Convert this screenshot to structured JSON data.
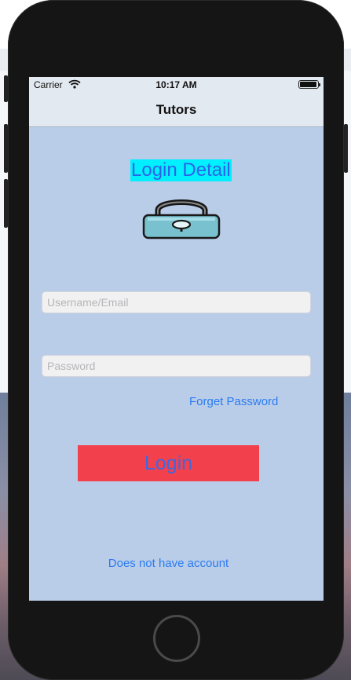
{
  "status_bar": {
    "carrier": "Carrier",
    "time": "10:17 AM"
  },
  "nav": {
    "title": "Tutors"
  },
  "main": {
    "heading": "Login Detail",
    "username": {
      "placeholder": "Username/Email",
      "value": ""
    },
    "password": {
      "placeholder": "Password",
      "value": ""
    },
    "forget_password_label": "Forget Password",
    "login_label": "Login",
    "no_account_label": "Does not have account"
  },
  "icons": [
    "wifi-icon",
    "battery-icon",
    "lock-icon"
  ],
  "colors": {
    "screen_background": "#b9cde9",
    "heading_background": "#00f0ff",
    "heading_text": "#2c63e8",
    "login_button_background": "#f2414d",
    "login_button_text": "#3f67e0",
    "link": "#2b7bef"
  }
}
